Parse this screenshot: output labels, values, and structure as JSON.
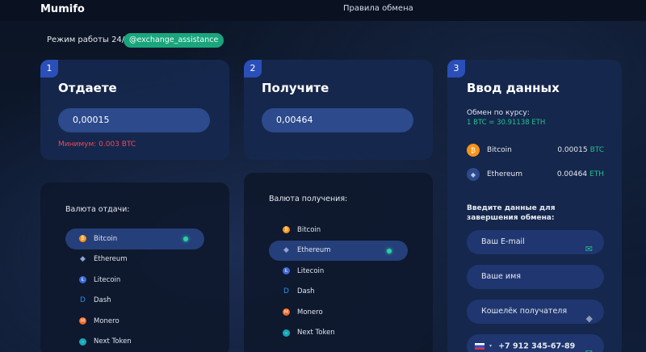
{
  "header": {
    "logo": "Mumifo",
    "nav_link": "Правила обмена"
  },
  "status": {
    "mode_text": "Режим работы 24/7",
    "telegram": "@exchange_assistance"
  },
  "give": {
    "number": "1",
    "title": "Отдаете",
    "amount": "0,00015",
    "minimum": "Минимум: 0.003 BTC",
    "list_label": "Валюта отдачи:",
    "coins": [
      "Bitcoin",
      "Ethereum",
      "Litecoin",
      "Dash",
      "Monero",
      "Next Token"
    ]
  },
  "get": {
    "number": "2",
    "title": "Получите",
    "amount": "0,00464",
    "list_label": "Валюта получения:",
    "coins": [
      "Bitcoin",
      "Ethereum",
      "Litecoin",
      "Dash",
      "Monero",
      "Next Token"
    ]
  },
  "details": {
    "number": "3",
    "title": "Ввод данных",
    "rate_label": "Обмен по курсу:",
    "rate_value": "1 BTC = 30.91138 ETH",
    "summary": [
      {
        "name": "Bitcoin",
        "amount": "0.00015",
        "currency": "BTC"
      },
      {
        "name": "Ethereum",
        "amount": "0.00464",
        "currency": "ETH"
      }
    ],
    "fill_label": "Введите данные для завершения обмена:",
    "email_placeholder": "Ваш E-mail",
    "name_placeholder": "Ваше имя",
    "wallet_placeholder": "Кошелёк получателя",
    "phone": "+7  912 345-67-89"
  },
  "colors": {
    "accent_green": "#22c08f",
    "bitcoin": "#f7931a",
    "error": "#ea4b5a",
    "badge": "#2a4fb8"
  },
  "icons": {
    "bitcoin": "bitcoin-icon",
    "ethereum": "ethereum-icon",
    "litecoin": "litecoin-icon",
    "dash": "dash-icon",
    "monero": "monero-icon",
    "next_token": "next-token-icon",
    "email": "envelope-icon",
    "wallet": "ethereum-icon",
    "phone_flag": "russia-flag-icon"
  }
}
